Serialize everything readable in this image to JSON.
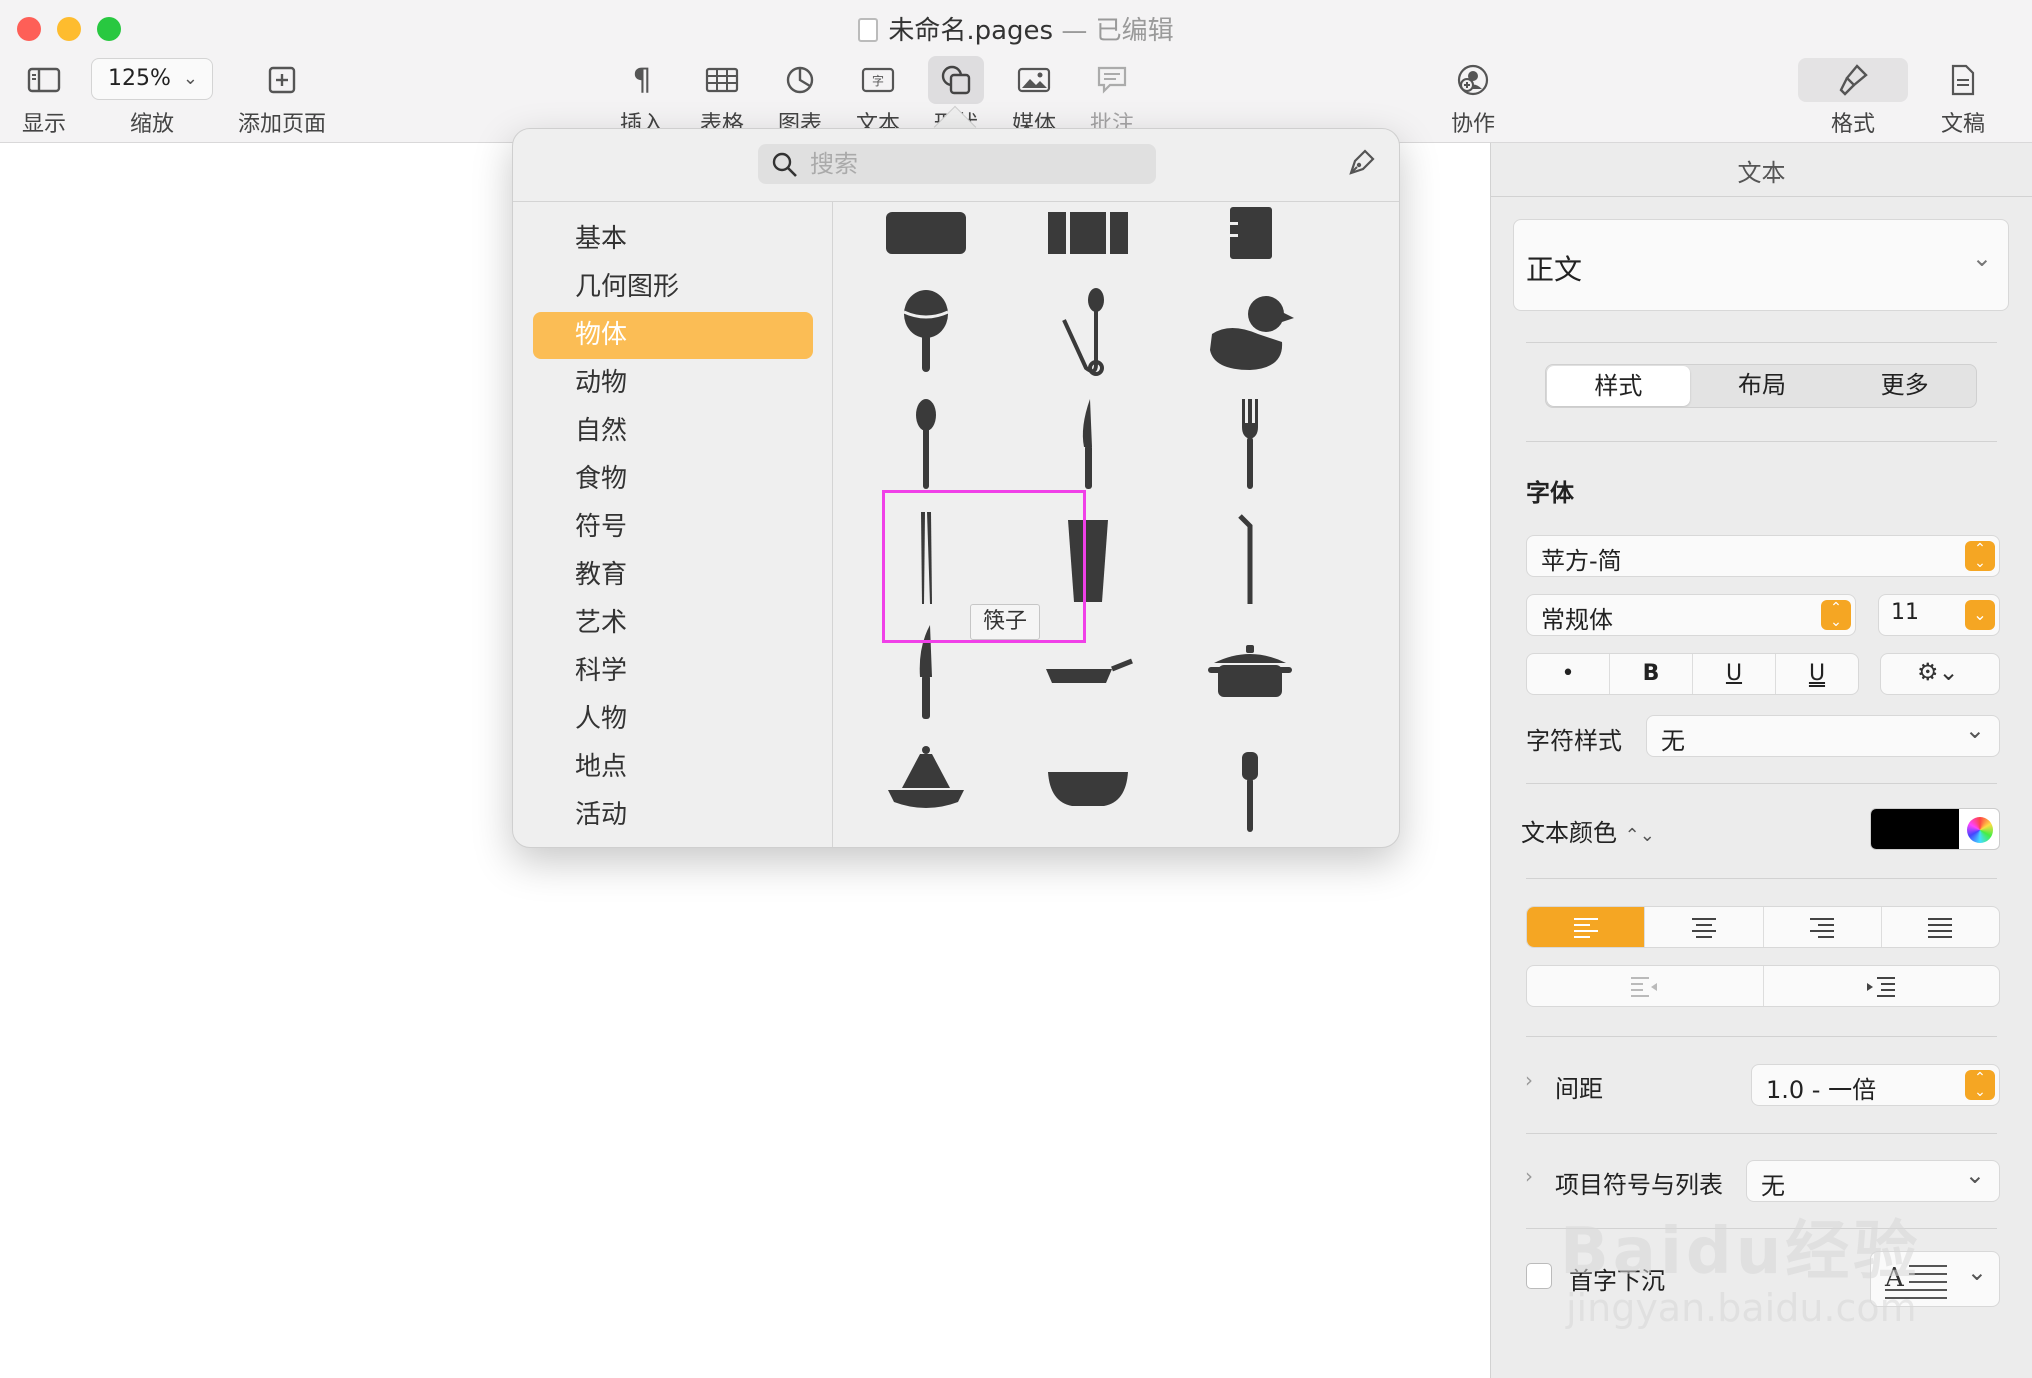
{
  "window": {
    "title": "未命名.pages",
    "title_separator": "—",
    "title_status": "已编辑"
  },
  "toolbar": {
    "view_label": "显示",
    "zoom_value": "125%",
    "zoom_label": "缩放",
    "add_page_label": "添加页面",
    "insert_label": "插入",
    "table_label": "表格",
    "chart_label": "图表",
    "text_label": "文本",
    "shape_label": "形状",
    "media_label": "媒体",
    "comment_label": "批注",
    "collaborate_label": "协作",
    "format_label": "格式",
    "document_label": "文稿"
  },
  "shape_popover": {
    "search_placeholder": "搜索",
    "categories": [
      "基本",
      "几何图形",
      "物体",
      "动物",
      "自然",
      "食物",
      "符号",
      "教育",
      "艺术",
      "科学",
      "人物",
      "地点",
      "活动"
    ],
    "selected_category": "物体",
    "tooltip": "筷子"
  },
  "inspector": {
    "header": "文本",
    "paragraph_style": "正文",
    "tabs": [
      "样式",
      "布局",
      "更多"
    ],
    "font_section": "字体",
    "font_family": "苹方-简",
    "font_style": "常规体",
    "font_size": "11",
    "format_buttons": [
      "•",
      "B",
      "U",
      "U"
    ],
    "char_style_label": "字符样式",
    "char_style_value": "无",
    "text_color_label": "文本颜色",
    "text_color": "#000000",
    "spacing_label": "间距",
    "spacing_value": "1.0 - 一倍",
    "bullets_label": "项目符号与列表",
    "bullets_value": "无",
    "drop_cap_label": "首字下沉"
  },
  "colors": {
    "accent": "#f5a623",
    "selected_category": "#fbbd55",
    "highlight_box": "#f040e8"
  },
  "watermark": {
    "brand": "Baidu经验",
    "url": "jingyan.baidu.com"
  }
}
